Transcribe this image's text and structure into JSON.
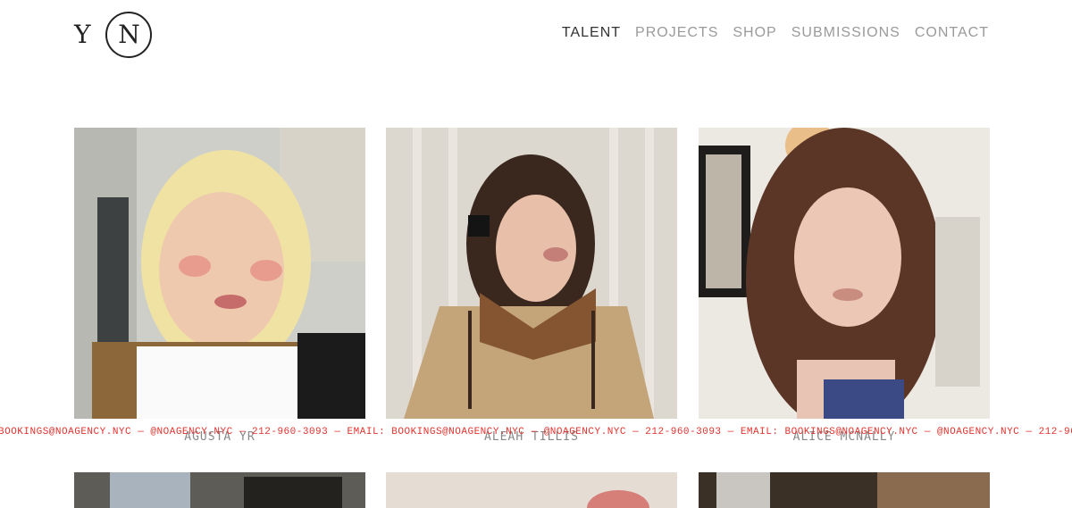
{
  "logo": {
    "left": "Y",
    "right": "N"
  },
  "nav": {
    "items": [
      {
        "label": "TALENT",
        "active": true
      },
      {
        "label": "PROJECTS",
        "active": false
      },
      {
        "label": "SHOP",
        "active": false
      },
      {
        "label": "SUBMISSIONS",
        "active": false
      },
      {
        "label": "CONTACT",
        "active": false
      }
    ]
  },
  "talent": [
    {
      "name": "AGUSTA YR"
    },
    {
      "name": "ALEAH TILLIS"
    },
    {
      "name": "ALICE MCNALLY"
    }
  ],
  "ticker": {
    "text": "BOOKINGS@NOAGENCY.NYC — @NOAGENCY.NYC — 212-960-3093 — EMAIL: BOOKINGS@NOAGENCY.NYC — @NOAGENCY.NYC — 212-960-3093 — EMAIL: BOOKINGS@NOAGENCY.NYC — @NOAGENCY.NYC — 212-960-3093"
  },
  "colors": {
    "accent": "#e2332f",
    "nav_active": "#333333",
    "nav_inactive": "#9a9a9a"
  }
}
